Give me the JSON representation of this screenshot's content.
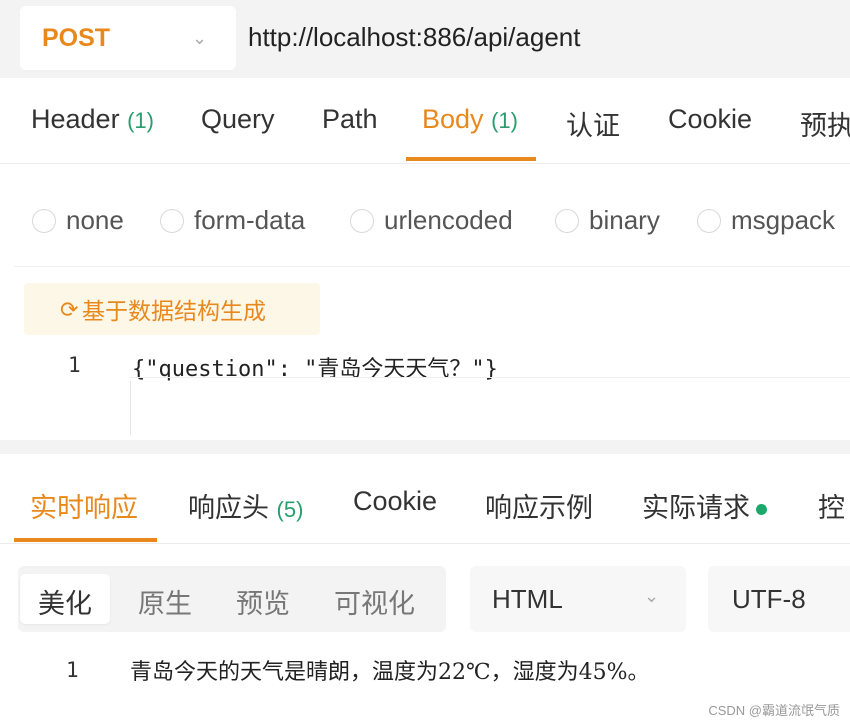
{
  "request": {
    "method": "POST",
    "url": "http://localhost:886/api/agent"
  },
  "request_tabs": [
    {
      "label": "Header",
      "count": "(1)"
    },
    {
      "label": "Query"
    },
    {
      "label": "Path"
    },
    {
      "label": "Body",
      "count": "(1)",
      "active": true
    },
    {
      "label": "认证"
    },
    {
      "label": "Cookie"
    },
    {
      "label": "预执"
    }
  ],
  "body_types": [
    "none",
    "form-data",
    "urlencoded",
    "binary",
    "msgpack"
  ],
  "editor": {
    "generate_button": "基于数据结构生成",
    "lines": [
      {
        "no": "1",
        "text": "{\"question\": \"青岛今天天气？\"}"
      }
    ]
  },
  "response_tabs": [
    {
      "label": "实时响应",
      "active": true
    },
    {
      "label": "响应头",
      "count": "(5)"
    },
    {
      "label": "Cookie"
    },
    {
      "label": "响应示例"
    },
    {
      "label": "实际请求",
      "dot": true
    },
    {
      "label": "控"
    }
  ],
  "view_modes": [
    "美化",
    "原生",
    "预览",
    "可视化"
  ],
  "format": "HTML",
  "encoding": "UTF-8",
  "response": {
    "lines": [
      {
        "no": "1",
        "text": "青岛今天的天气是晴朗，温度为22℃，湿度为45%。"
      }
    ]
  },
  "watermark": "CSDN @霸道流氓气质",
  "colors": {
    "accent": "#e8891d",
    "count": "#2a9d6e",
    "dot": "#1aa96b"
  }
}
